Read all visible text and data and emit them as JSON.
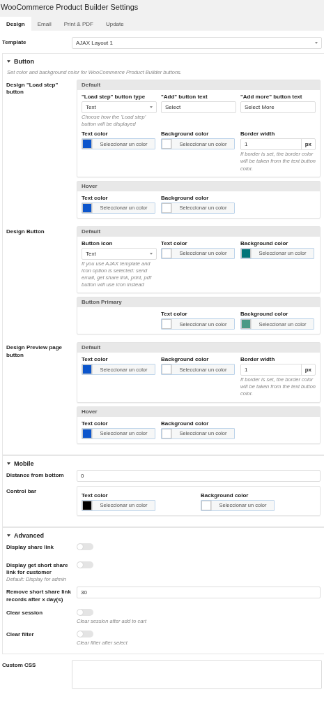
{
  "title": "WooCommerce Product Builder Settings",
  "tabs": [
    {
      "label": "Design",
      "selected": true
    },
    {
      "label": "Email",
      "selected": false
    },
    {
      "label": "Print & PDF",
      "selected": false
    },
    {
      "label": "Update",
      "selected": false
    }
  ],
  "template": {
    "label": "Template",
    "value": "AJAX Layout 1"
  },
  "sections": [
    {
      "title": "Button",
      "expanded": true,
      "description": "Set color and background color for WooCommerce Product Builder buttons.",
      "rows": [
        {
          "kind": "panels",
          "label": "Design \"Load step\" button",
          "panels": [
            {
              "header": "Default",
              "fields": [
                {
                  "kind": "select",
                  "label": "\"Load step\" button type",
                  "value": "Text",
                  "hint": "Choose how the 'Load step' button will be displayed"
                },
                {
                  "kind": "text",
                  "label": "\"Add\" button text",
                  "value": "Select"
                },
                {
                  "kind": "text",
                  "label": "\"Add more\" button text",
                  "value": "Select More"
                },
                {
                  "kind": "color",
                  "label": "Text color",
                  "color": "#0b55cc",
                  "button": "Seleccionar un color"
                },
                {
                  "kind": "color",
                  "label": "Background color",
                  "color": "#ffffff",
                  "button": "Seleccionar un color"
                },
                {
                  "kind": "number",
                  "label": "Border width",
                  "value": "1",
                  "unit": "px",
                  "hint": "If border is set, the border color will be taken from the text button color."
                }
              ]
            },
            {
              "header": "Hover",
              "fields": [
                {
                  "kind": "color",
                  "label": "Text color",
                  "color": "#0b55cc",
                  "button": "Seleccionar un color"
                },
                {
                  "kind": "color",
                  "label": "Background color",
                  "color": "#ffffff",
                  "button": "Seleccionar un color"
                }
              ]
            }
          ]
        },
        {
          "kind": "panels",
          "label": "Design Button",
          "panels": [
            {
              "header": "Default",
              "fields": [
                {
                  "kind": "select",
                  "label": "Button icon",
                  "value": "Text",
                  "hint": "If you use AJAX template and icon option is selected: send email, get share link, print, pdf button will use icon instead"
                },
                {
                  "kind": "color",
                  "label": "Text color",
                  "color": "#ffffff",
                  "button": "Seleccionar un color"
                },
                {
                  "kind": "color",
                  "label": "Background color",
                  "color": "#00747a",
                  "button": "Seleccionar un color"
                }
              ]
            },
            {
              "header": "Button Primary",
              "fields": [
                {
                  "kind": "blank"
                },
                {
                  "kind": "color",
                  "label": "Text color",
                  "color": "#ffffff",
                  "button": "Seleccionar un color"
                },
                {
                  "kind": "color",
                  "label": "Background color",
                  "color": "#4a9a87",
                  "button": "Seleccionar un color"
                }
              ]
            }
          ]
        },
        {
          "kind": "panels",
          "label": "Design Preview page button",
          "panels": [
            {
              "header": "Default",
              "fields": [
                {
                  "kind": "color",
                  "label": "Text color",
                  "color": "#0b55cc",
                  "button": "Seleccionar un color"
                },
                {
                  "kind": "color",
                  "label": "Background color",
                  "color": "#ffffff",
                  "button": "Seleccionar un color"
                },
                {
                  "kind": "number",
                  "label": "Border width",
                  "value": "1",
                  "unit": "px",
                  "hint": "If border is set, the border color will be taken from the text button color."
                }
              ]
            },
            {
              "header": "Hover",
              "fields": [
                {
                  "kind": "color",
                  "label": "Text color",
                  "color": "#0b55cc",
                  "button": "Seleccionar un color"
                },
                {
                  "kind": "color",
                  "label": "Background color",
                  "color": "#ffffff",
                  "button": "Seleccionar un color"
                }
              ]
            }
          ]
        }
      ]
    },
    {
      "title": "Mobile",
      "expanded": true,
      "rows": [
        {
          "kind": "input",
          "label": "Distance from bottom",
          "value": "0"
        },
        {
          "kind": "panels",
          "label": "Control bar",
          "panels": [
            {
              "fields": [
                {
                  "kind": "color",
                  "label": "Text color",
                  "color": "#000000",
                  "button": "Seleccionar un color"
                },
                {
                  "kind": "color",
                  "label": "Background color",
                  "color": "#ffffff",
                  "button": "Seleccionar un color"
                }
              ]
            }
          ]
        }
      ]
    },
    {
      "title": "Advanced",
      "expanded": true,
      "rows": [
        {
          "kind": "toggle",
          "label": "Display share link",
          "on": false
        },
        {
          "kind": "toggle",
          "label": "Display get short share link for customer",
          "sublabel": "Default: Display for admin",
          "on": false
        },
        {
          "kind": "input",
          "label": "Remove short share link records after x day(s)",
          "value": "30"
        },
        {
          "kind": "toggle",
          "label": "Clear session",
          "on": false,
          "hint": "Clear session after add to cart"
        },
        {
          "kind": "toggle",
          "label": "Clear filter",
          "on": false,
          "hint": "Clear filter after select"
        }
      ]
    }
  ],
  "custom_css": {
    "label": "Custom CSS"
  }
}
